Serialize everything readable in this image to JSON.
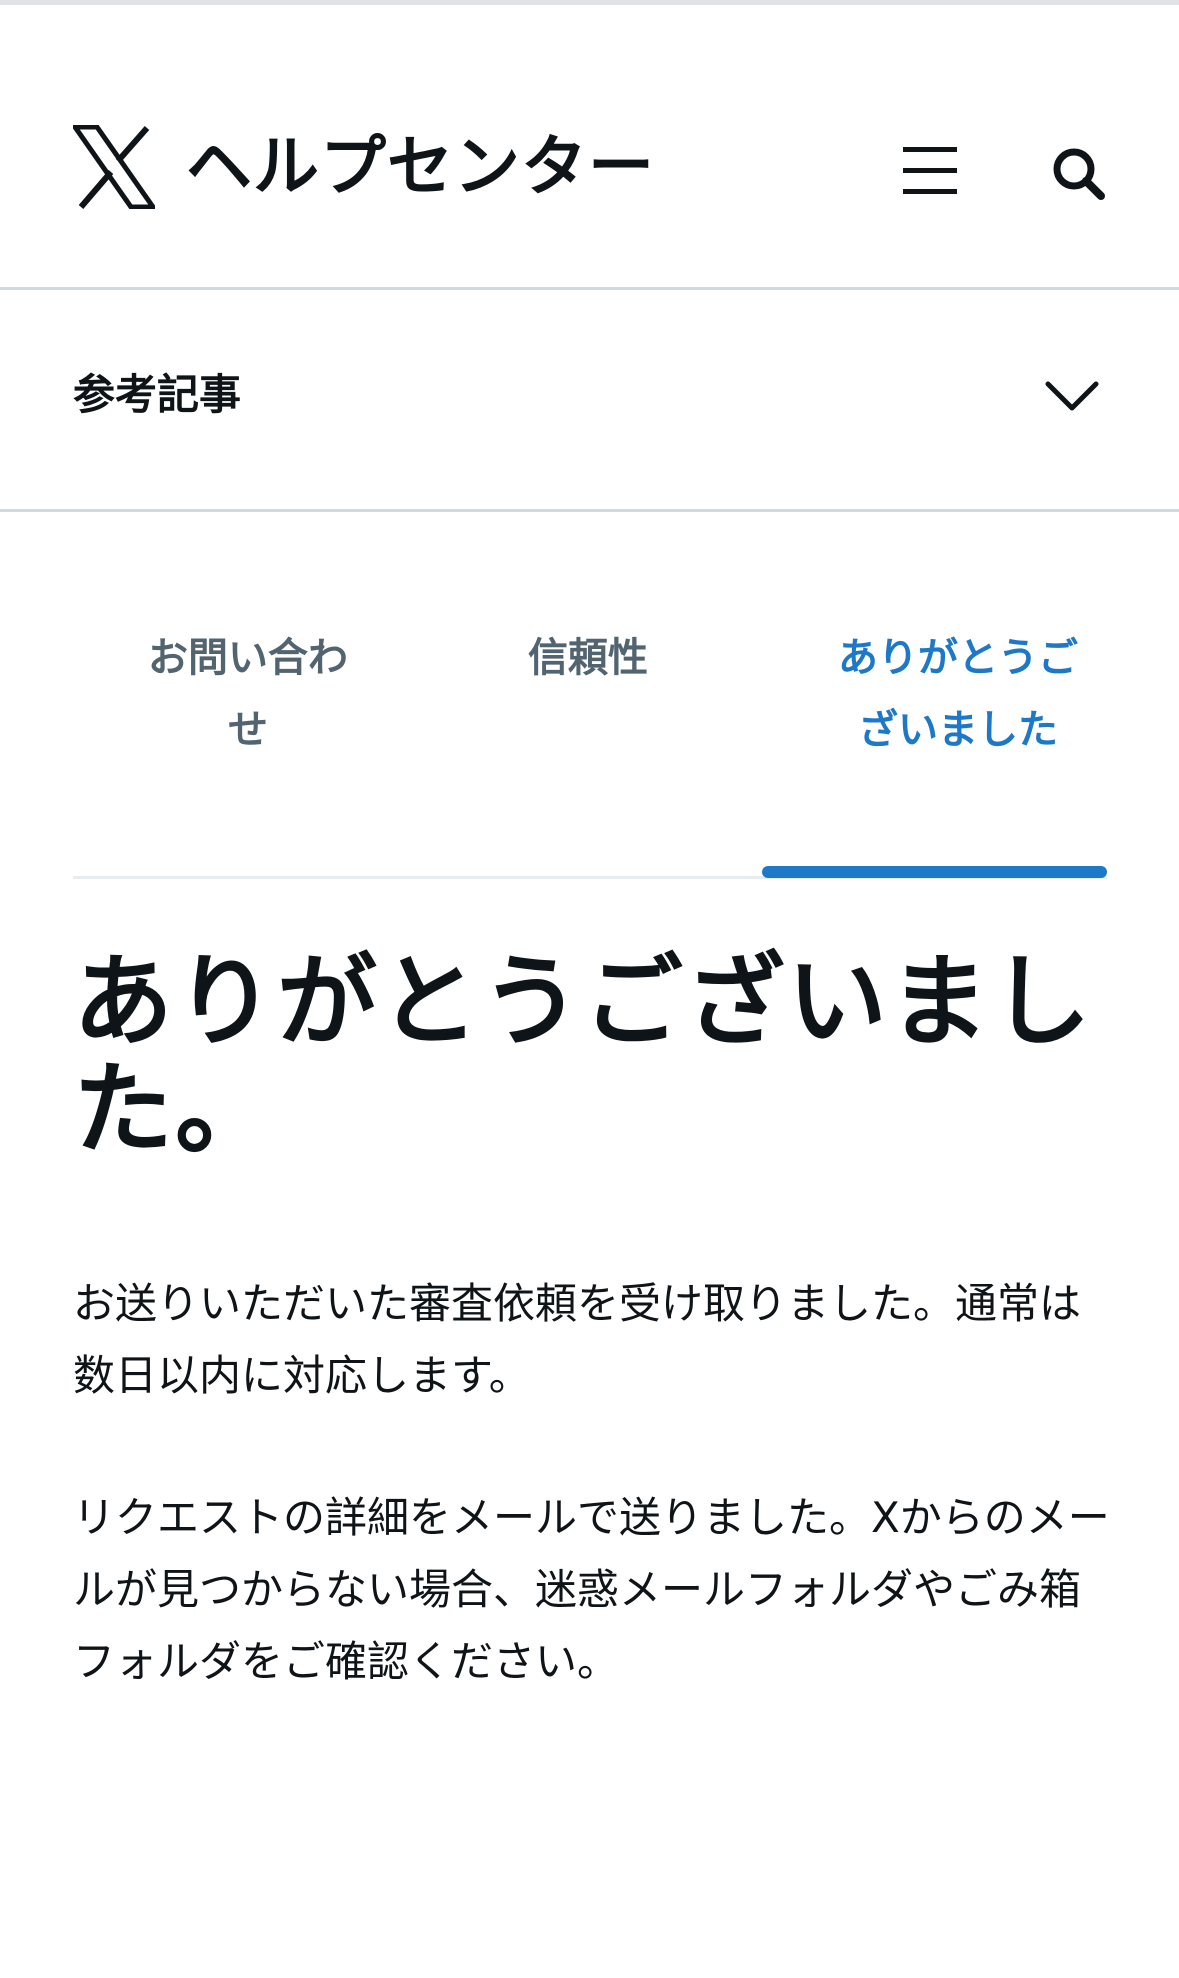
{
  "header": {
    "site_title": "ヘルプセンター",
    "logo_icon": "x-logo-icon",
    "menu_icon": "hamburger-menu-icon",
    "search_icon": "search-icon"
  },
  "related_articles": {
    "label": "参考記事",
    "toggle_icon": "chevron-down-icon"
  },
  "tabs": [
    {
      "label": "お問い合わせ",
      "active": false
    },
    {
      "label": "信頼性",
      "active": false
    },
    {
      "label": "ありがとうございました",
      "active": true
    }
  ],
  "colors": {
    "accent": "#1d79c8",
    "inactive_tab": "#536471",
    "text": "#0f1419",
    "divider": "#cfd9de"
  },
  "content": {
    "title": "ありがとうございました。",
    "paragraph1": "お送りいただいた審査依頼を受け取りました。通常は数日以内に対応します。",
    "paragraph2": "リクエストの詳細をメールで送りました。Xからのメールが見つからない場合、迷惑メールフォルダやごみ箱フォルダをご確認ください。"
  }
}
